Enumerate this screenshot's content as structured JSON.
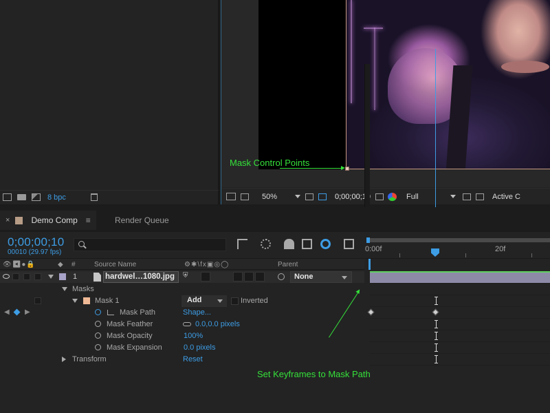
{
  "project": {
    "bit_depth": "8 bpc"
  },
  "viewer": {
    "zoom": "50%",
    "timecode": "0;00;00;10",
    "resolution": "Full",
    "camera": "Active C"
  },
  "annotations": {
    "mask_points": "Mask Control Points",
    "keyframes": "Set Keyframes to Mask Path"
  },
  "timeline": {
    "tabs": [
      {
        "label": "Demo Comp",
        "close": "×",
        "menu": "≡"
      },
      {
        "label": "Render Queue"
      }
    ],
    "timecode": "0;00;00;10",
    "frames": "00010 (29.97 fps)",
    "ruler": {
      "start": "0:00f",
      "mark": "20f"
    },
    "columns": {
      "av": "👁◀●🔒",
      "label": "◆",
      "number": "#",
      "source_name": "Source Name",
      "switches": "⚙✱\\fx▣◎◯",
      "parent": "Parent"
    },
    "layer": {
      "number": "1",
      "name": "hardwel…1080.jpg",
      "parent": "None"
    },
    "masks_group": "Masks",
    "mask": {
      "name": "Mask 1",
      "mode": "Add",
      "inverted": "Inverted"
    },
    "properties": [
      {
        "name": "Mask Path",
        "value": "Shape..."
      },
      {
        "name": "Mask Feather",
        "value": "0.0,0.0 pixels"
      },
      {
        "name": "Mask Opacity",
        "value": "100%"
      },
      {
        "name": "Mask Expansion",
        "value": "0.0 pixels"
      }
    ],
    "transform": {
      "name": "Transform",
      "value": "Reset"
    }
  },
  "colors": {
    "accent": "#3d9de5",
    "annotation": "#35e13a",
    "layer_label": "#a7a2c8",
    "mask_color": "#f0b996"
  }
}
